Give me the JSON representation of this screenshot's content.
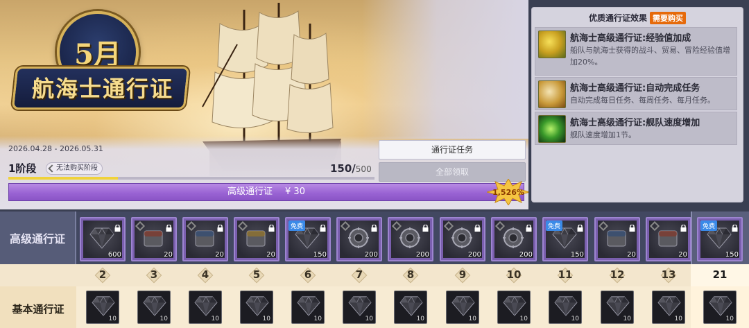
{
  "banner": {
    "month": "5月",
    "title": "航海士通行证",
    "dates": "2026.04.28 - 2026.05.31",
    "stage": "1阶段",
    "stage_badge": "无法购买阶段",
    "progress_current": "150/",
    "progress_max": "500",
    "xp_fraction": 0.3,
    "btn_tasks": "通行证任务",
    "btn_claim": "全部领取",
    "premium_label": "高级通行证",
    "premium_price": "¥ 30",
    "discount": "1,526%"
  },
  "effects": {
    "header": "优质通行证效果",
    "buy_tag": "需要购买",
    "items": [
      {
        "name": "航海士高级通行证:经验值加成",
        "desc": "船队与航海士获得的战斗、贸易、冒险经验值增加20%。",
        "icon": "xp-boost-icon"
      },
      {
        "name": "航海士高级通行证:自动完成任务",
        "desc": "自动完成每日任务、每周任务、每月任务。",
        "icon": "auto-quest-icon"
      },
      {
        "name": "航海士高级通行证:舰队速度增加",
        "desc": "舰队速度增加1节。",
        "icon": "fleet-speed-icon"
      }
    ]
  },
  "rewards": {
    "premium_label": "高级通行证",
    "basic_label": "基本通行证",
    "free_tag": "免费",
    "levels": [
      "2",
      "3",
      "4",
      "5",
      "6",
      "7",
      "8",
      "9",
      "10",
      "11",
      "12",
      "13",
      "21"
    ],
    "premium": [
      {
        "qty": "600",
        "kind": "gem",
        "free": false
      },
      {
        "qty": "20",
        "kind": "chest-red",
        "free": false
      },
      {
        "qty": "20",
        "kind": "chest-blue",
        "free": false
      },
      {
        "qty": "20",
        "kind": "chest-gold",
        "free": false
      },
      {
        "qty": "150",
        "kind": "gem",
        "free": true
      },
      {
        "qty": "200",
        "kind": "gear",
        "free": false
      },
      {
        "qty": "200",
        "kind": "gear",
        "free": false
      },
      {
        "qty": "200",
        "kind": "gear",
        "free": false
      },
      {
        "qty": "200",
        "kind": "gear",
        "free": false
      },
      {
        "qty": "150",
        "kind": "gem",
        "free": true
      },
      {
        "qty": "20",
        "kind": "chest-blue",
        "free": false
      },
      {
        "qty": "20",
        "kind": "chest-red",
        "free": false
      },
      {
        "qty": "150",
        "kind": "gem",
        "free": true
      }
    ],
    "basic": [
      "10",
      "10",
      "10",
      "10",
      "10",
      "10",
      "10",
      "10",
      "10",
      "10",
      "10",
      "10",
      "10"
    ]
  },
  "colors": {
    "premium_bar": "#9a64d4",
    "buy_tag": "#e66a0a",
    "free_tag": "#3a8ae8",
    "xp_fill": "#f0d23a"
  }
}
